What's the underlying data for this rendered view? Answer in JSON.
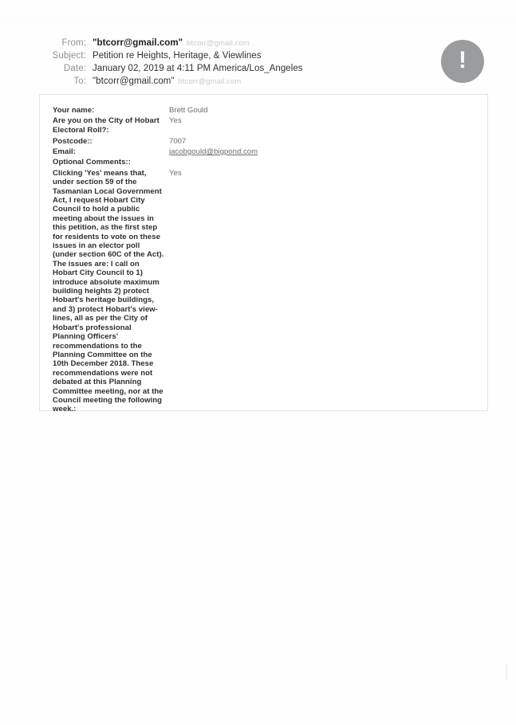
{
  "document": {
    "type": "scanned-email-printout",
    "alert_icon": "exclamation-icon",
    "alert_glyph": "!"
  },
  "mail_header": {
    "rows": [
      {
        "label": "From:",
        "value": "\"btcorr@gmail.com\"",
        "bold": true,
        "faint": "btcorr@gmail.com"
      },
      {
        "label": "Subject:",
        "value": "Petition re Heights, Heritage, & Viewlines",
        "bold": false,
        "faint": ""
      },
      {
        "label": "Date:",
        "value": "January 02, 2019 at 4:11 PM America/Los_Angeles",
        "bold": false,
        "faint": ""
      },
      {
        "label": "To:",
        "value": "\"btcorr@gmail.com\"",
        "bold": false,
        "faint": "btcorr@gmail.com"
      }
    ]
  },
  "response_table": {
    "rows": [
      {
        "question": "Your name:",
        "answer": "Brett Gould",
        "is_link": false
      },
      {
        "question": "Are you on the City of Hobart Electoral Roll?:",
        "answer": "Yes",
        "is_link": false
      },
      {
        "question": "Postcode::",
        "answer": "7007",
        "is_link": false
      },
      {
        "question": "Email:",
        "answer": "jacobgould@bigpond.com",
        "is_link": true
      },
      {
        "question": "Optional Comments::",
        "answer": "",
        "is_link": false
      },
      {
        "question": "Clicking 'Yes' means that, under section 59 of the Tasmanian Local Government Act, I request Hobart City Council to hold a public meeting about the issues in this petition, as the first step for residents to vote on these issues in an elector poll (under section 60C of the Act). The issues are: I call on Hobart City Council to 1) introduce absolute maximum building heights 2) protect Hobart's heritage buildings, and 3) protect Hobart's view-lines, all as per the City of Hobart's professional Planning Officers' recommendations to the Planning Committee on the 10th December 2018. These recommendations were not debated at this Planning Committee meeting, nor at the Council meeting the following week.:",
        "answer": "Yes",
        "is_link": false
      }
    ]
  },
  "colors": {
    "label_grey": "#8e9094",
    "value_dark": "#2f3032",
    "faint_grey": "#c9cbcd",
    "badge_grey": "#9b9c9e",
    "table_border": "#e2e3e5",
    "answer_grey": "#6a6c6f"
  }
}
